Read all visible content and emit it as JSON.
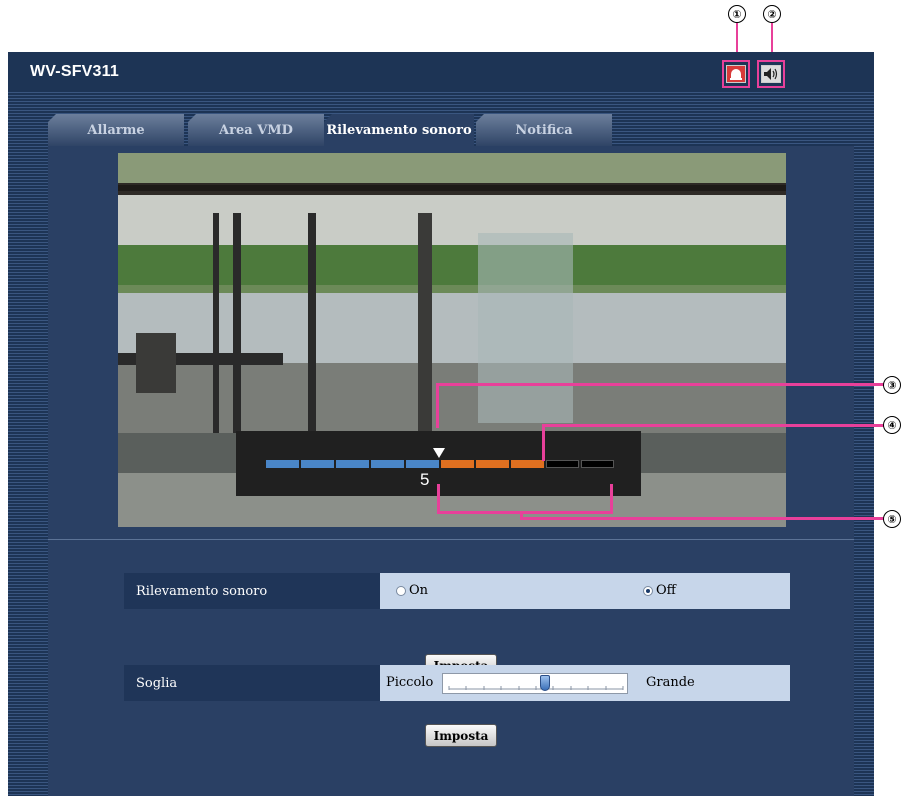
{
  "app": {
    "title": "WV-SFV311"
  },
  "header_buttons": [
    {
      "icon": "alarm-icon"
    },
    {
      "icon": "speaker-icon"
    }
  ],
  "tabs": [
    {
      "label": "Allarme",
      "active": false
    },
    {
      "label": "Area VMD",
      "active": false
    },
    {
      "label": "Rilevamento sonoro",
      "active": true
    },
    {
      "label": "Notifica",
      "active": false
    }
  ],
  "sound_meter": {
    "value_label": "5",
    "level": 5,
    "threshold": 5,
    "segments": 10
  },
  "callouts": [
    "①",
    "②",
    "③",
    "④",
    "⑤"
  ],
  "detection": {
    "label": "Rilevamento sonoro",
    "options": [
      {
        "label": "On",
        "selected": false
      },
      {
        "label": "Off",
        "selected": true
      }
    ],
    "apply_label": "Imposta"
  },
  "threshold": {
    "label": "Soglia",
    "min_label": "Piccolo",
    "max_label": "Grande",
    "value_fraction": 0.55,
    "apply_label": "Imposta"
  },
  "colors": {
    "accent": "#e8409a",
    "background": "#1d3455",
    "panel": "#2a4064",
    "meter_low": "#4a86c8",
    "meter_high": "#e07020"
  }
}
